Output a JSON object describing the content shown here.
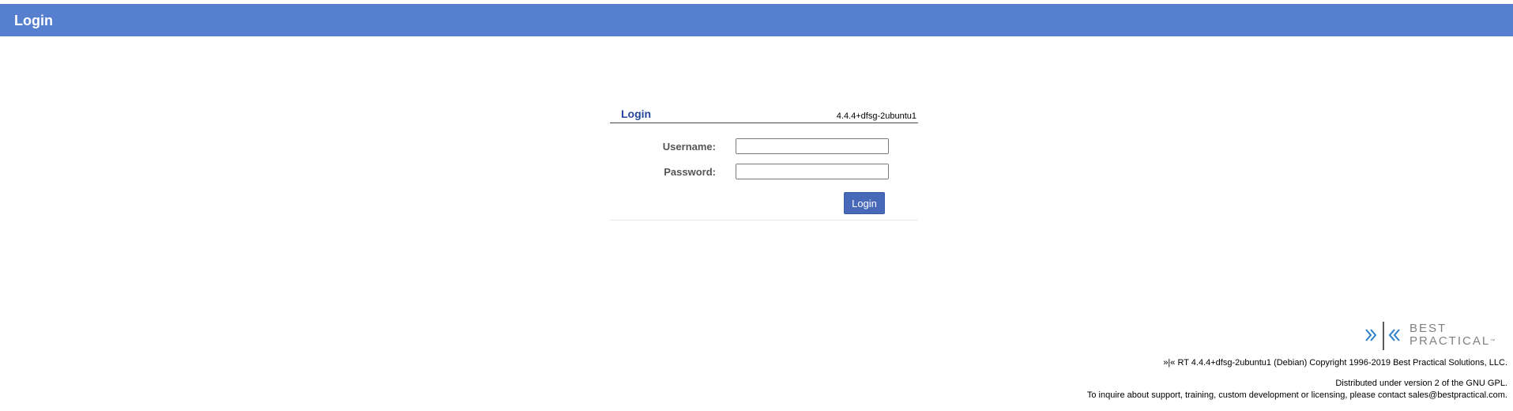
{
  "header": {
    "title": "Login"
  },
  "login_box": {
    "title": "Login",
    "version": "4.4.4+dfsg-2ubuntu1",
    "username_label": "Username:",
    "password_label": "Password:",
    "username_value": "",
    "password_value": "",
    "submit_label": "Login"
  },
  "logo": {
    "line1": "BEST",
    "line2": "PRACTICAL",
    "trademark": "™",
    "icon": "best-practical-chevrons-icon"
  },
  "footer": {
    "copyright": "»|« RT 4.4.4+dfsg-2ubuntu1 (Debian) Copyright 1996-2019 Best Practical Solutions, LLC.",
    "license": "Distributed under version 2 of the GNU GPL.",
    "contact": "To inquire about support, training, custom development or licensing, please contact sales@bestpractical.com."
  },
  "colors": {
    "header_bg": "#5680cf",
    "title_blue": "#27479a",
    "button_bg": "#4868b8",
    "logo_blue": "#2d7fc9",
    "logo_gray": "#808080"
  }
}
